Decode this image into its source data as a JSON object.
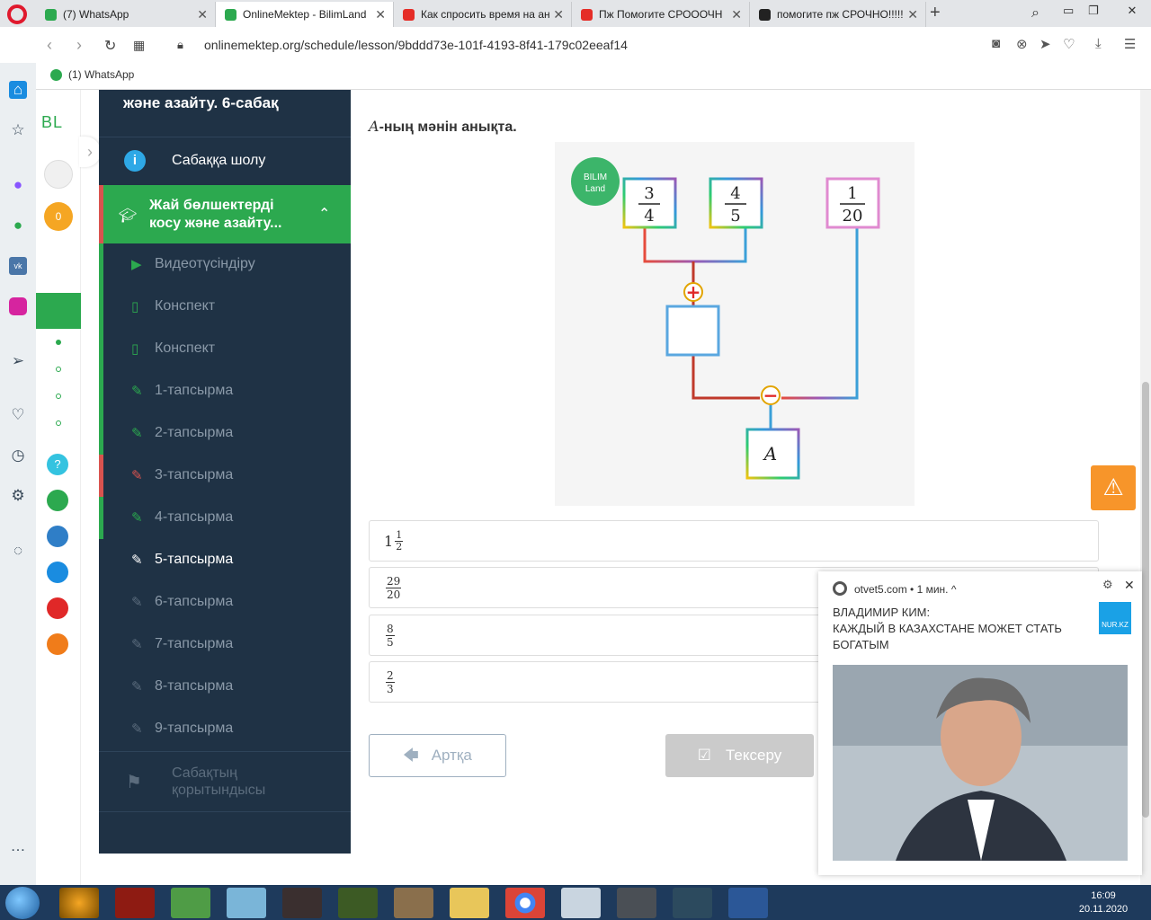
{
  "browser": {
    "tabs": [
      {
        "title": "(7) WhatsApp",
        "color": "#2ca94f"
      },
      {
        "title": "OnlineMektep - BilimLand",
        "color": "#2ca94f"
      },
      {
        "title": "Как спросить время на ан",
        "color": "#e52d27"
      },
      {
        "title": "Пж Помогите СРОООЧН",
        "color": "#e52d27"
      },
      {
        "title": "помогите пж СРОЧНО!!!!!",
        "color": "#222222"
      }
    ],
    "new_tab": "+",
    "url": "onlinemektep.org/schedule/lesson/9bddd73e-101f-4193-8f41-179c02eeaf14",
    "bookmark": "(1) WhatsApp"
  },
  "rail": {
    "logo": "BL",
    "coins": "0",
    "help": "?"
  },
  "sidebar": {
    "title": "және азайту. 6-сабақ",
    "overview": "Сабаққа шолу",
    "section": "Жай бөлшектерді косу және азайту...",
    "items": [
      {
        "label": "Видеотүсіндіру",
        "icon": "play-icon",
        "bar": "#2ca94f",
        "icon_color": "#2ca94f"
      },
      {
        "label": "Конспект",
        "icon": "book-icon",
        "bar": "#2ca94f",
        "icon_color": "#2ca94f"
      },
      {
        "label": "Конспект",
        "icon": "book-icon",
        "bar": "#2ca94f",
        "icon_color": "#2ca94f"
      },
      {
        "label": "1-тапсырма",
        "icon": "edit-icon",
        "bar": "#2ca94f",
        "icon_color": "#2ca94f"
      },
      {
        "label": "2-тапсырма",
        "icon": "edit-icon",
        "bar": "#2ca94f",
        "icon_color": "#2ca94f"
      },
      {
        "label": "3-тапсырма",
        "icon": "edit-icon",
        "bar": "#d9534f",
        "icon_color": "#d9534f"
      },
      {
        "label": "4-тапсырма",
        "icon": "edit-icon",
        "bar": "#2ca94f",
        "icon_color": "#2ca94f"
      },
      {
        "label": "5-тапсырма",
        "icon": "edit-icon",
        "bar": "#1f3245",
        "icon_color": "#ffffff",
        "current": true
      },
      {
        "label": "6-тапсырма",
        "icon": "edit-icon",
        "bar": "#1f3245",
        "icon_color": "#5b6c7d"
      },
      {
        "label": "7-тапсырма",
        "icon": "edit-icon",
        "bar": "#1f3245",
        "icon_color": "#5b6c7d"
      },
      {
        "label": "8-тапсырма",
        "icon": "edit-icon",
        "bar": "#1f3245",
        "icon_color": "#5b6c7d"
      },
      {
        "label": "9-тапсырма",
        "icon": "edit-icon",
        "bar": "#1f3245",
        "icon_color": "#5b6c7d"
      }
    ],
    "summary": "Сабақтың қорытындысы"
  },
  "task": {
    "question_var": "A",
    "question_text": "-ның мәнін анықта.",
    "diagram": {
      "badge": "BILIM Land",
      "box1": {
        "num": "3",
        "den": "4"
      },
      "box2": {
        "num": "4",
        "den": "5"
      },
      "box3": {
        "num": "1",
        "den": "20"
      },
      "result": "A",
      "plus": "+",
      "minus": "−"
    },
    "options": [
      {
        "whole": "1",
        "num": "1",
        "den": "2"
      },
      {
        "num": "29",
        "den": "20"
      },
      {
        "num": "8",
        "den": "5"
      },
      {
        "num": "2",
        "den": "3"
      }
    ],
    "back_label": "Артқа",
    "check_label": "Тексеру"
  },
  "ad": {
    "source": "otvet5.com",
    "age": "• 1 мин. ^",
    "headline": "ВЛАДИМИР КИМ:",
    "body": "КАЖДЫЙ В КАЗАХСТАНЕ МОЖЕТ СТАТЬ БОГАТЫМ",
    "logo": "NUR.KZ"
  },
  "taskbar": {
    "time": "16:09",
    "date": "20.11.2020"
  }
}
